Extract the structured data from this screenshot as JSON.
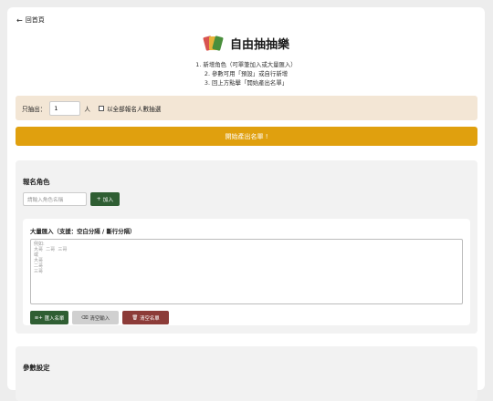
{
  "nav": {
    "back_icon": "arrow-left-icon",
    "back_label": "回首頁"
  },
  "header": {
    "icon": "playing-cards-icon",
    "title": "自由抽抽樂"
  },
  "instructions": [
    "1. 新增角色（可單筆加入或大量匯入）",
    "2. 參數可用「預設」或自行新增",
    "3. 回上方點擊「開始產出名單」"
  ],
  "draw": {
    "label": "只抽出：",
    "value": "1",
    "unit": "人",
    "all_label": "以全部報名人數抽選",
    "all_checked": false
  },
  "start_button": "開始產出名單 !",
  "register": {
    "title": "報名角色",
    "name_placeholder": "請輸入角色名稱",
    "add_label": "加入",
    "add_icon": "plus-icon",
    "bulk": {
      "title": "大量匯入（支援：空白分隔 / 斷行分隔）",
      "placeholder": "例如:\n大哥  二哥  三哥\n或\n大哥\n二哥\n三哥",
      "import_label": "匯入名單",
      "import_icon": "list-add-icon",
      "clear_input_label": "清空輸入",
      "clear_input_icon": "eraser-icon",
      "clear_list_label": "清空名單",
      "clear_list_icon": "trash-icon"
    }
  },
  "params": {
    "title": "參數設定"
  },
  "colors": {
    "accent": "#e0a00e",
    "green": "#2f5e33",
    "danger": "#8c3b38",
    "panel": "#f3e6d5"
  }
}
